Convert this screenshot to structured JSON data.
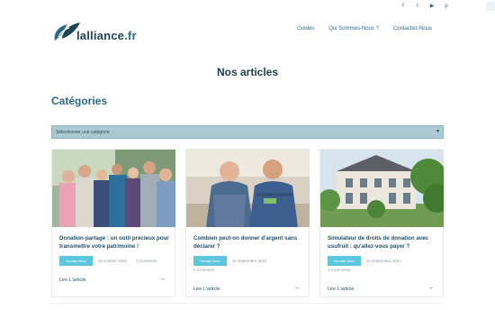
{
  "social": {
    "facebook": "f",
    "twitter": "t",
    "youtube": "▶",
    "pinterest": "p"
  },
  "logo": {
    "main": "lalliance",
    "suffix": ".fr"
  },
  "nav": {
    "guides": "Guides",
    "about": "Qui Sommes-Nous ?",
    "contact": "Contactez-Nous"
  },
  "page_title": "Nos articles",
  "categories_title": "Catégories",
  "category_select": {
    "value": "Sélectionner une catégorie"
  },
  "articles": [
    {
      "title": "Donation-partage : un outil précieux pour transmettre votre patrimoine !",
      "author": "Nicolas Bern",
      "date": "15 octobre 2021",
      "comments": "0 Comment",
      "read_more": "Lire L'article"
    },
    {
      "title": "Combien peut-on donner d'argent sans déclarer ?",
      "author": "Nicolas Bern",
      "date": "10 septembre 2021",
      "comments": "0 Comment",
      "read_more": "Lire L'article"
    },
    {
      "title": "Simulateur de droits de donation avec usufruit : qu'allez-vous payer ?",
      "author": "Nicolas Bern",
      "date": "10 septembre 2021",
      "comments": "3 Comments",
      "read_more": "Lire L'article"
    }
  ],
  "colors": {
    "accent": "#2a6a86",
    "badge": "#5bc6dc",
    "select": "#a9c9d3"
  }
}
